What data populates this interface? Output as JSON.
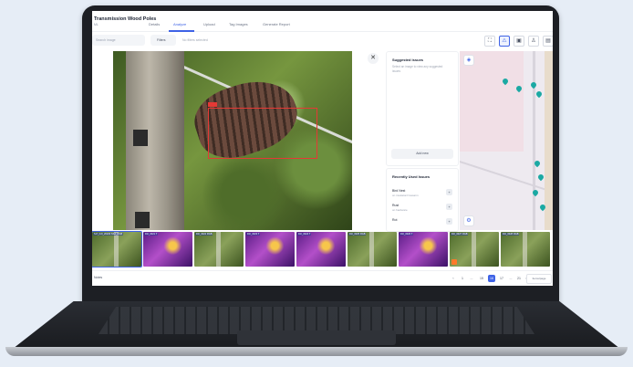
{
  "app": {
    "title": "Transmission Wood Poles",
    "subtitle": "ML"
  },
  "tabs": [
    {
      "label": "Details"
    },
    {
      "label": "Analyze"
    },
    {
      "label": "Upload"
    },
    {
      "label": "Tag Images"
    },
    {
      "label": "Generate Report"
    }
  ],
  "toolbar": {
    "search_placeholder": "Search image",
    "filters_label": "Filters",
    "filters_note": "No filters selected"
  },
  "suggested_issues": {
    "title": "Suggested issues",
    "body": "Select an image to view any suggested issues",
    "add_label": "Add new"
  },
  "recent_issues": {
    "title": "Recently Used Issues",
    "items": [
      {
        "name": "Bird Nest",
        "detail": "on insulator/crossarm"
      },
      {
        "name": "Rust",
        "detail": "on hardware"
      },
      {
        "name": "Rot",
        "detail": ""
      }
    ]
  },
  "filmstrip": {
    "thumbs": [
      {
        "label": "S.P_DJI_20230 SSA_RGB",
        "kind": "rgb",
        "selected": true
      },
      {
        "label": "DJI_0021 T",
        "kind": "thermal"
      },
      {
        "label": "DJI_0022 RGB",
        "kind": "rgb"
      },
      {
        "label": "DJI_0023 T",
        "kind": "thermal"
      },
      {
        "label": "DJI_0024 T",
        "kind": "thermal"
      },
      {
        "label": "DJI_0025 RGB",
        "kind": "rgb"
      },
      {
        "label": "DJI_0026 T",
        "kind": "thermal"
      },
      {
        "label": "DJI_0027 RGB",
        "kind": "rgb"
      },
      {
        "label": "DJI_0028 RGB",
        "kind": "rgb"
      },
      {
        "label": "DJI_0029 T",
        "kind": "thermal"
      }
    ]
  },
  "footer": {
    "left_label": "Notes",
    "pages": [
      "1",
      "...",
      "15",
      "16",
      "17",
      "...",
      "21"
    ],
    "active_page": "16",
    "per_page_label": "Items/page"
  },
  "icons": {
    "close": "close-icon",
    "layers": "layers-icon",
    "filter": "filter-icon"
  },
  "colors": {
    "accent": "#3f63e6",
    "bbox": "#e53935",
    "marker": "#1ba9a3"
  }
}
